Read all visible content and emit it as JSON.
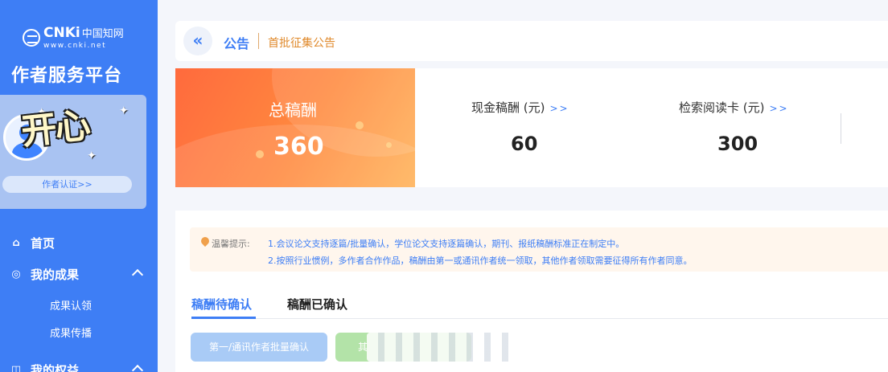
{
  "sidebar": {
    "logo_main": "CNKi",
    "logo_cn": "中国知网",
    "logo_sub": "www.cnki.net",
    "platform_title": "作者服务平台",
    "author_verify": "作者认证>>",
    "sticker_text": "开心",
    "nav": {
      "home": "首页",
      "achievements": "我的成果",
      "claim": "成果认领",
      "spread": "成果传播",
      "rights": "我的权益"
    }
  },
  "notice": {
    "label": "公告",
    "text": "首批征集公告"
  },
  "stats": {
    "total_label": "总稿酬",
    "total_value": "360",
    "cash_label": "现金稿酬 (元)",
    "cash_value": "60",
    "card_label": "检索阅读卡 (元)",
    "card_value": "300",
    "more": ">>"
  },
  "tips": {
    "label": "温馨提示:",
    "line1": "1.会议论文支持逐篇/批量确认，学位论文支持逐篇确认，期刊、报纸稿酬标准正在制定中。",
    "line2": "2.按照行业惯例，多作者合作作品，稿酬由第一或通讯作者统一领取，其他作者领取需要征得所有作者同意。"
  },
  "tabs": {
    "pending": "稿酬待确认",
    "confirmed": "稿酬已确认"
  },
  "buttons": {
    "batch_confirm": "第一/通讯作者批量确认",
    "other": "其"
  },
  "colors": {
    "brand_blue": "#3e7ef5",
    "total_orange": "#ff7a3e",
    "notice_orange": "#e08a2c"
  }
}
